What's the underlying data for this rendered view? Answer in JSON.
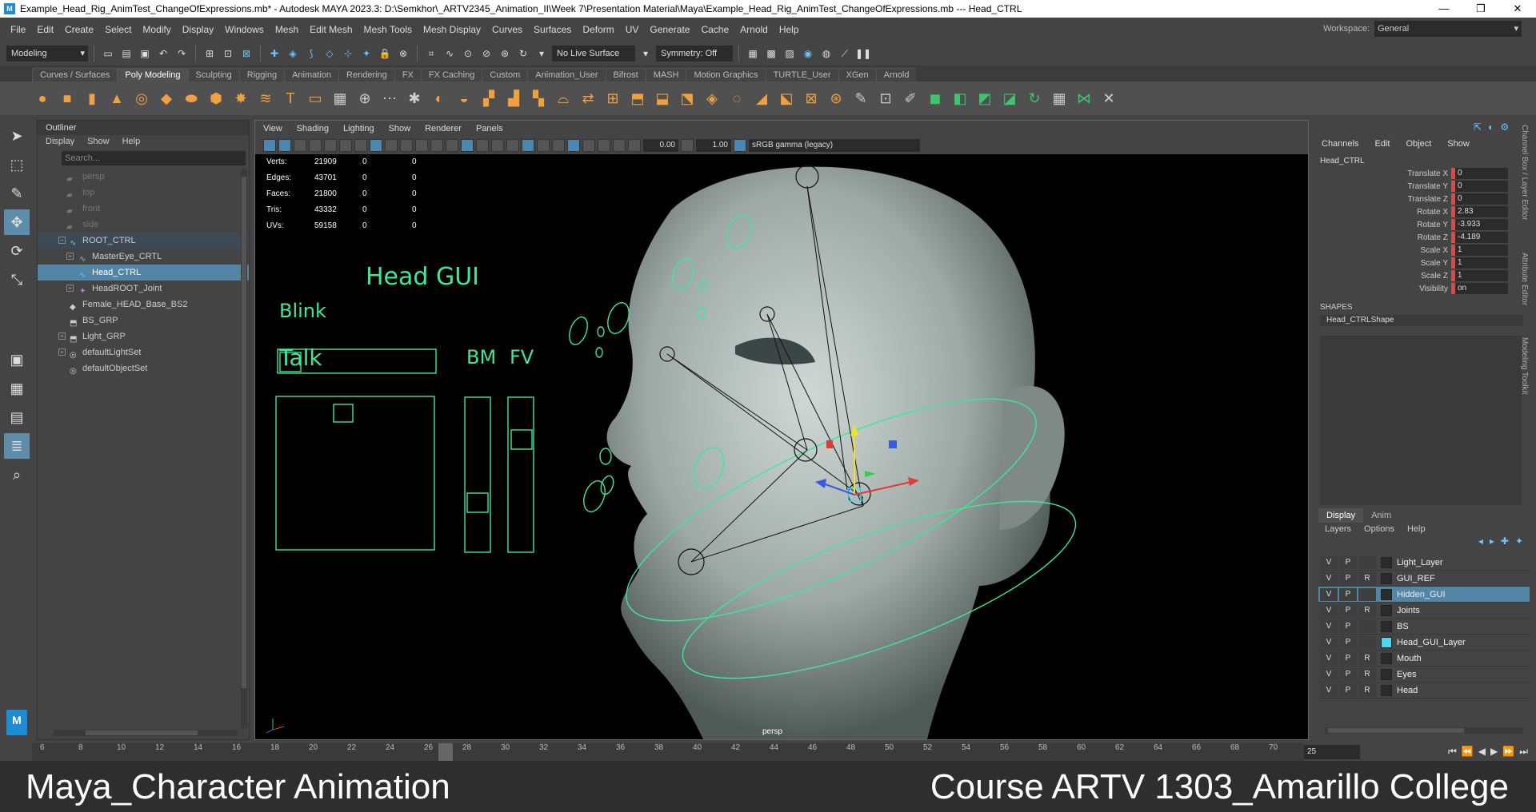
{
  "title_bar": {
    "text": "Example_Head_Rig_AnimTest_ChangeOfExpressions.mb* - Autodesk MAYA 2023.3: D:\\Semkhor\\_ARTV2345_Animation_II\\Week 7\\Presentation Material\\Maya\\Example_Head_Rig_AnimTest_ChangeOfExpressions.mb  ---  Head_CTRL",
    "minimize": "—",
    "restore": "❐",
    "close": "✕"
  },
  "menu": [
    "File",
    "Edit",
    "Create",
    "Select",
    "Modify",
    "Display",
    "Windows",
    "Mesh",
    "Edit Mesh",
    "Mesh Tools",
    "Mesh Display",
    "Curves",
    "Surfaces",
    "Deform",
    "UV",
    "Generate",
    "Cache",
    "Arnold",
    "Help"
  ],
  "workspace": {
    "label": "Workspace:",
    "value": "General"
  },
  "status": {
    "mode": "Modeling",
    "live_surface": "No Live Surface",
    "symmetry": "Symmetry: Off"
  },
  "shelf_tabs": [
    "Curves / Surfaces",
    "Poly Modeling",
    "Sculpting",
    "Rigging",
    "Animation",
    "Rendering",
    "FX",
    "FX Caching",
    "Custom",
    "Animation_User",
    "Bifrost",
    "MASH",
    "Motion Graphics",
    "TURTLE_User",
    "XGen",
    "Arnold"
  ],
  "shelf_active": "Poly Modeling",
  "outliner": {
    "title": "Outliner",
    "menu": [
      "Display",
      "Show",
      "Help"
    ],
    "search_placeholder": "Search...",
    "items": [
      {
        "label": "persp",
        "dim": true
      },
      {
        "label": "top",
        "dim": true
      },
      {
        "label": "front",
        "dim": true
      },
      {
        "label": "side",
        "dim": true
      },
      {
        "label": "ROOT_CTRL"
      },
      {
        "label": "MasterEye_CRTL"
      },
      {
        "label": "Head_CTRL",
        "selected": true
      },
      {
        "label": "HeadROOT_Joint"
      },
      {
        "label": "Female_HEAD_Base_BS2"
      },
      {
        "label": "BS_GRP"
      },
      {
        "label": "Light_GRP"
      },
      {
        "label": "defaultLightSet"
      },
      {
        "label": "defaultObjectSet"
      }
    ]
  },
  "viewport": {
    "menu": [
      "View",
      "Shading",
      "Lighting",
      "Show",
      "Renderer",
      "Panels"
    ],
    "exposure": "0.00",
    "gamma": "1.00",
    "color_mgmt": "sRGB gamma (legacy)",
    "camera": "persp",
    "hud": [
      {
        "k": "Verts:",
        "v": "21909",
        "a": "0",
        "b": "0"
      },
      {
        "k": "Edges:",
        "v": "43701",
        "a": "0",
        "b": "0"
      },
      {
        "k": "Faces:",
        "v": "21800",
        "a": "0",
        "b": "0"
      },
      {
        "k": "Tris:",
        "v": "43332",
        "a": "0",
        "b": "0"
      },
      {
        "k": "UVs:",
        "v": "59158",
        "a": "0",
        "b": "0"
      }
    ],
    "gui": {
      "title": "Head GUI",
      "blink": "Blink",
      "talk": "Talk",
      "bm": "BM",
      "fv": "FV"
    }
  },
  "channel_box": {
    "menu": [
      "Channels",
      "Edit",
      "Object",
      "Show"
    ],
    "object": "Head_CTRL",
    "attrs": [
      {
        "n": "Translate X",
        "v": "0"
      },
      {
        "n": "Translate Y",
        "v": "0"
      },
      {
        "n": "Translate Z",
        "v": "0"
      },
      {
        "n": "Rotate X",
        "v": "2.83"
      },
      {
        "n": "Rotate Y",
        "v": "-3.933"
      },
      {
        "n": "Rotate Z",
        "v": "-4.189"
      },
      {
        "n": "Scale X",
        "v": "1"
      },
      {
        "n": "Scale Y",
        "v": "1"
      },
      {
        "n": "Scale Z",
        "v": "1"
      },
      {
        "n": "Visibility",
        "v": "on"
      }
    ],
    "shapes_label": "SHAPES",
    "shape": "Head_CTRLShape",
    "side_tabs": [
      "Channel Box / Layer Editor",
      "Attribute Editor",
      "Modeling Toolkit"
    ]
  },
  "layer_editor": {
    "tabs": [
      "Display",
      "Anim"
    ],
    "menu": [
      "Layers",
      "Options",
      "Help"
    ],
    "layers": [
      {
        "v": "V",
        "p": "P",
        "r": "",
        "name": "Light_Layer",
        "color": ""
      },
      {
        "v": "V",
        "p": "P",
        "r": "R",
        "name": "GUI_REF",
        "color": ""
      },
      {
        "v": "V",
        "p": "P",
        "r": "",
        "name": "Hidden_GUI",
        "color": "",
        "selected": true
      },
      {
        "v": "V",
        "p": "P",
        "r": "R",
        "name": "Joints",
        "color": ""
      },
      {
        "v": "V",
        "p": "P",
        "r": "",
        "name": "BS",
        "color": ""
      },
      {
        "v": "V",
        "p": "P",
        "r": "",
        "name": "Head_GUI_Layer",
        "color": "#4fd7f0"
      },
      {
        "v": "V",
        "p": "P",
        "r": "R",
        "name": "Mouth",
        "color": ""
      },
      {
        "v": "V",
        "p": "P",
        "r": "R",
        "name": "Eyes",
        "color": ""
      },
      {
        "v": "V",
        "p": "P",
        "r": "R",
        "name": "Head",
        "color": ""
      }
    ]
  },
  "timeline": {
    "ticks": [
      "6",
      "8",
      "10",
      "12",
      "14",
      "16",
      "18",
      "20",
      "22",
      "24",
      "26",
      "28",
      "30",
      "32",
      "34",
      "36",
      "38",
      "40",
      "42",
      "44",
      "46",
      "48",
      "50",
      "52",
      "54",
      "56",
      "58",
      "60",
      "62",
      "64",
      "66",
      "68",
      "70"
    ],
    "current": "25"
  },
  "banner": {
    "left": "Maya_Character Animation",
    "right": "Course ARTV 1303_Amarillo College"
  }
}
